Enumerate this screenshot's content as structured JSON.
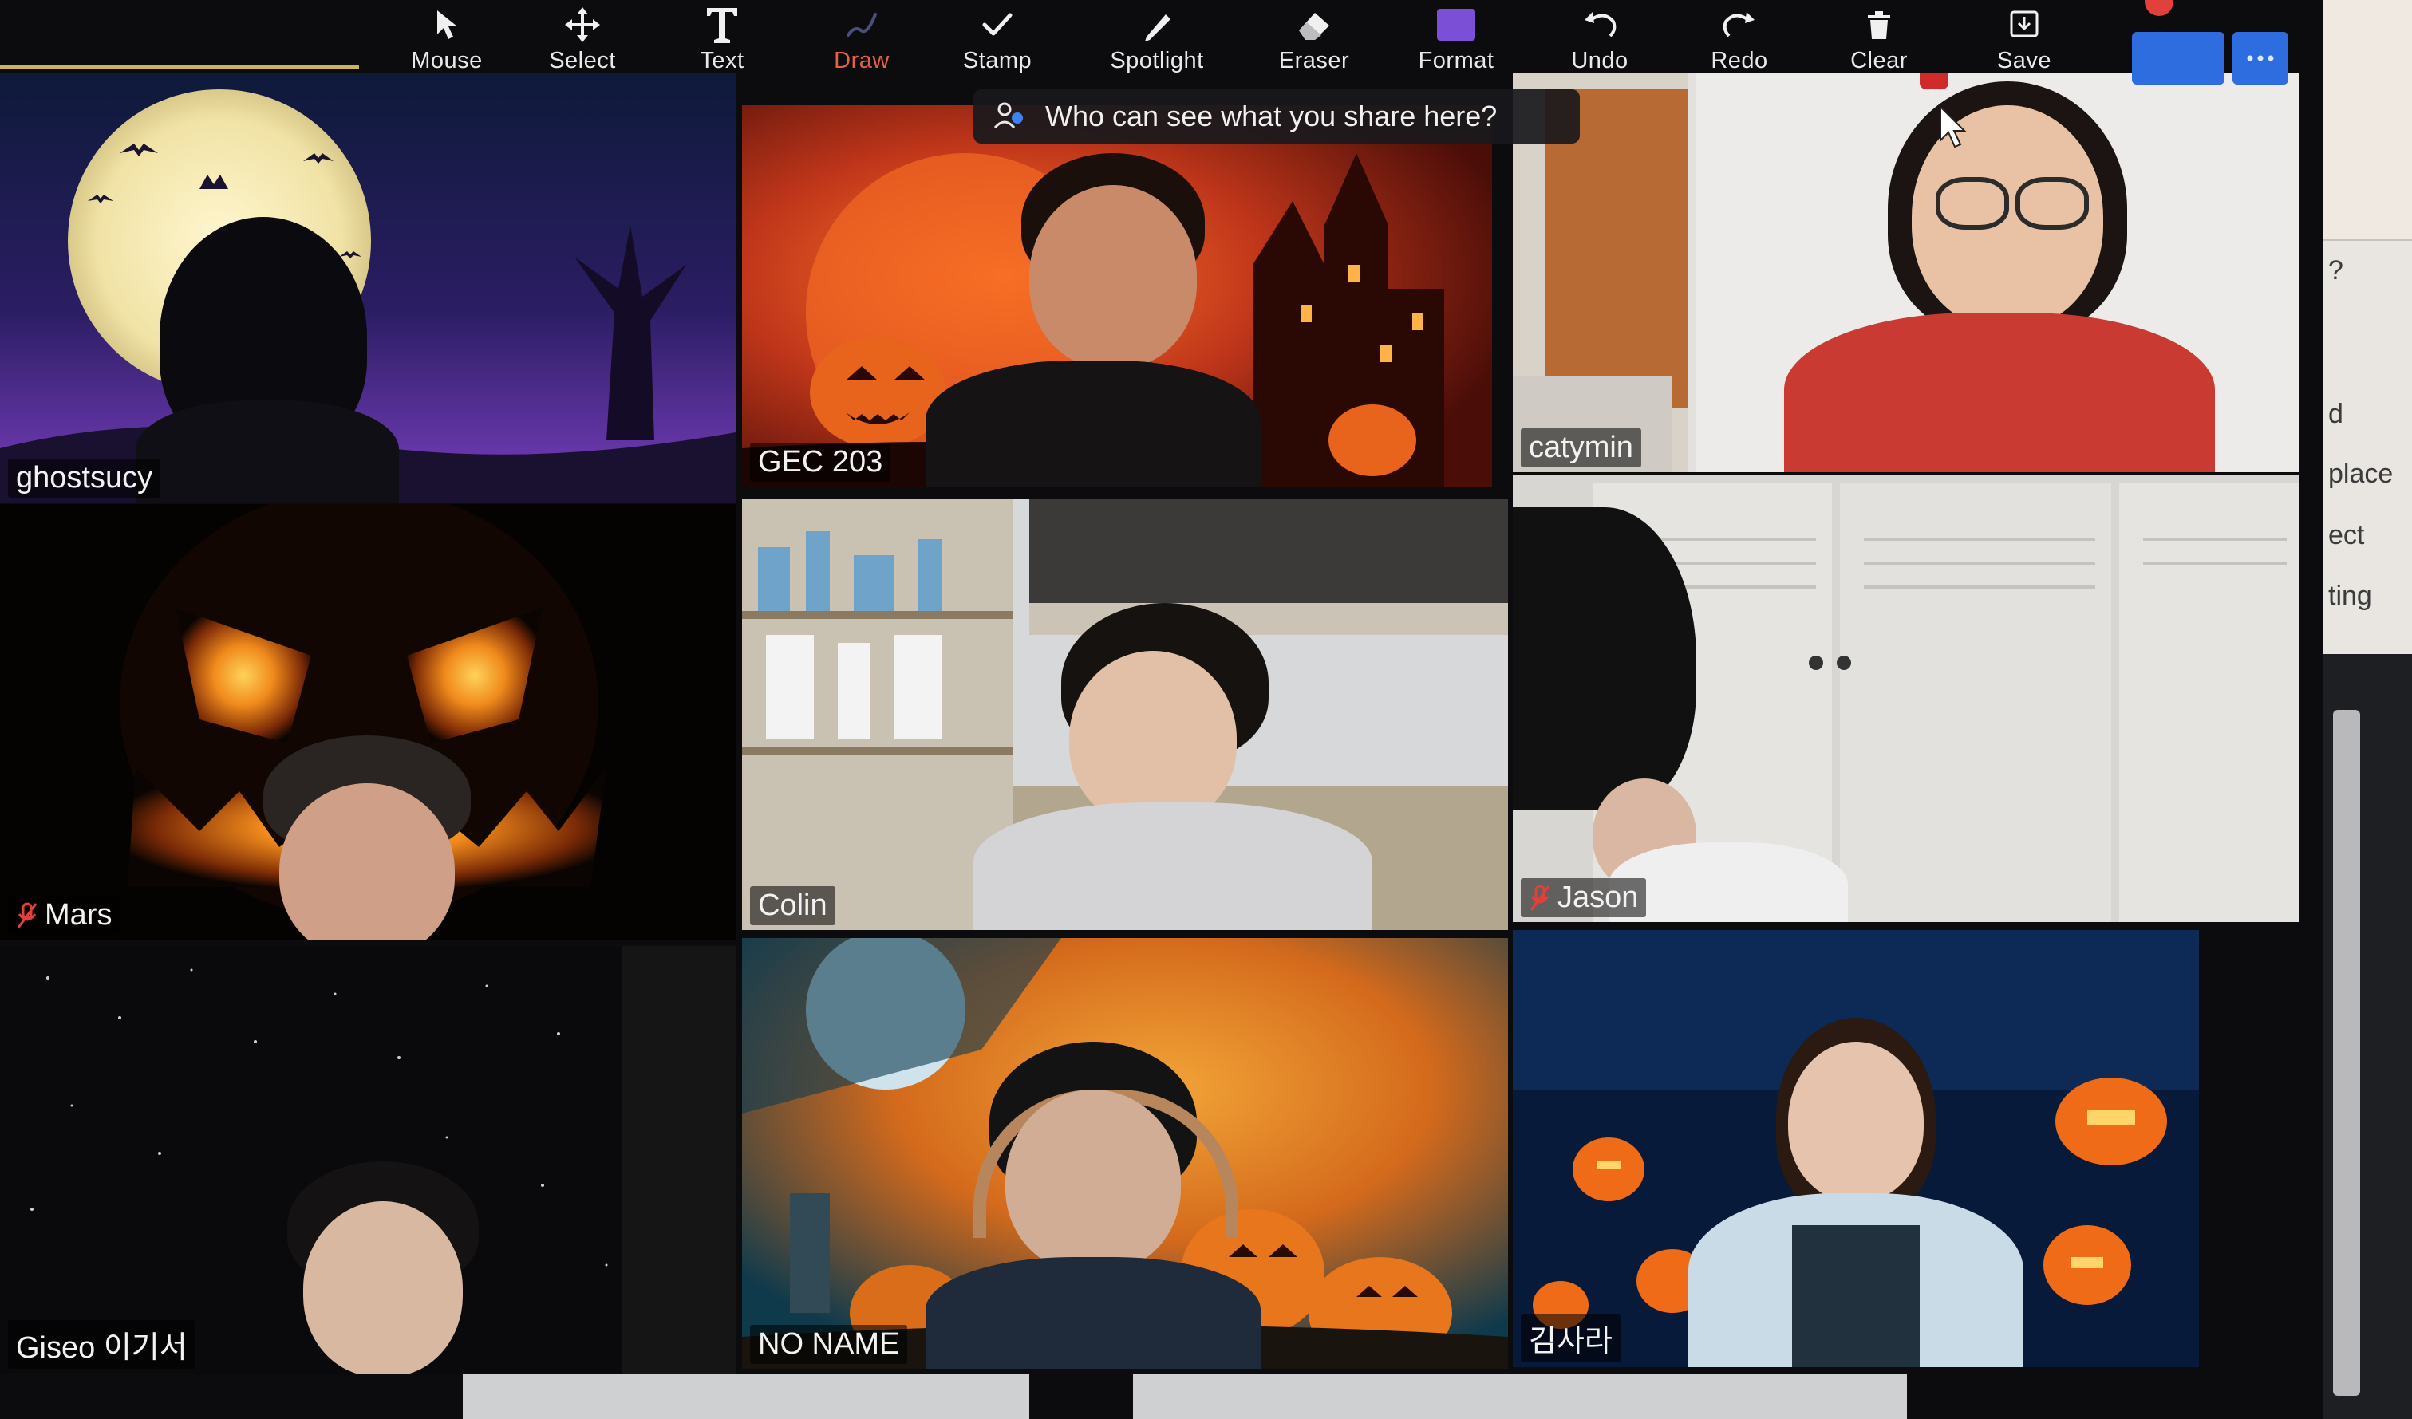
{
  "toolbar": {
    "tools": [
      {
        "id": "mouse",
        "label": "Mouse",
        "icon": "mouse-pointer-icon"
      },
      {
        "id": "select",
        "label": "Select",
        "icon": "move-arrows-icon"
      },
      {
        "id": "text",
        "label": "Text",
        "icon": "text-t-icon"
      },
      {
        "id": "draw",
        "label": "Draw",
        "icon": "pencil-squiggle-icon",
        "active": true
      },
      {
        "id": "stamp",
        "label": "Stamp",
        "icon": "checkmark-stamp-icon"
      },
      {
        "id": "spotlight",
        "label": "Spotlight",
        "icon": "spotlight-pen-icon"
      },
      {
        "id": "eraser",
        "label": "Eraser",
        "icon": "eraser-icon"
      },
      {
        "id": "format",
        "label": "Format",
        "icon": "color-swatch-icon"
      },
      {
        "id": "undo",
        "label": "Undo",
        "icon": "undo-arrow-icon"
      },
      {
        "id": "redo",
        "label": "Redo",
        "icon": "redo-arrow-icon"
      },
      {
        "id": "clear",
        "label": "Clear",
        "icon": "trash-icon"
      },
      {
        "id": "save",
        "label": "Save",
        "icon": "download-icon"
      }
    ],
    "active_color": "#e3623f",
    "format_swatch_color": "#7b4fd6"
  },
  "share_banner": {
    "text": "Who can see what you share here?",
    "icon": "people-icon"
  },
  "side_panel": {
    "texts": [
      "?",
      "d",
      "place",
      "ect",
      "ting"
    ]
  },
  "participants": [
    {
      "id": "ghostsucy",
      "name": "ghostsucy",
      "muted": false,
      "speaking": true,
      "background": "full-moon-night"
    },
    {
      "id": "gec203",
      "name": "GEC 203",
      "muted": false,
      "speaking": false,
      "background": "haunted-house-orange"
    },
    {
      "id": "catymin",
      "name": "catymin",
      "muted": false,
      "speaking": false,
      "background": "room-interior"
    },
    {
      "id": "mars",
      "name": "Mars",
      "muted": true,
      "speaking": false,
      "background": "jack-o-lantern-face"
    },
    {
      "id": "colin",
      "name": "Colin",
      "muted": false,
      "speaking": false,
      "background": "shelves-room"
    },
    {
      "id": "jason",
      "name": "Jason",
      "muted": true,
      "speaking": false,
      "background": "white-closet"
    },
    {
      "id": "giseo",
      "name": "Giseo 이기서",
      "muted": false,
      "speaking": false,
      "background": "starry-night"
    },
    {
      "id": "noname",
      "name": "NO NAME",
      "muted": false,
      "speaking": false,
      "background": "pumpkin-patch-moon"
    },
    {
      "id": "sara",
      "name": "김사라",
      "muted": false,
      "speaking": false,
      "background": "glowing-pumpkins"
    }
  ],
  "colors": {
    "speaker_outline": "#d6c64f",
    "mute_red": "#e0413a",
    "button_blue": "#2d6de0"
  }
}
